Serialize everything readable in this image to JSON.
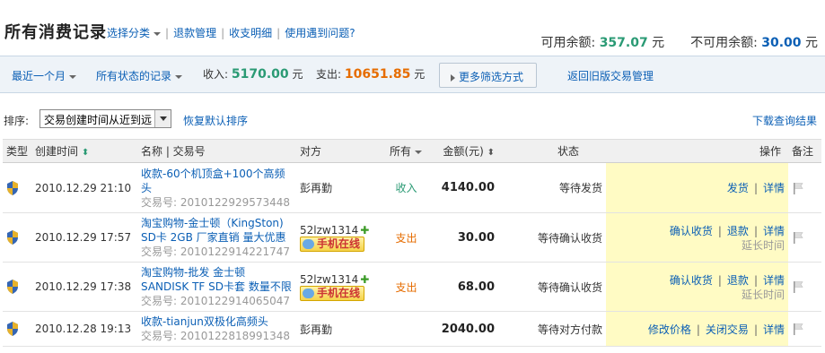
{
  "header": {
    "title": "所有消费记录",
    "links": [
      "选择分类",
      "退款管理",
      "收支明细",
      "使用遇到问题?"
    ],
    "available_label": "可用余额:",
    "available_value": "357.07",
    "unavailable_label": "不可用余额:",
    "unavailable_value": "30.00",
    "currency": "元"
  },
  "filter": {
    "period": "最近一个月",
    "status": "所有状态的记录",
    "income_label": "收入:",
    "income_value": "5170.00",
    "expense_label": "支出:",
    "expense_value": "10651.85",
    "currency": "元",
    "more_button": "更多筛选方式",
    "old_link": "返回旧版交易管理"
  },
  "sort": {
    "label": "排序:",
    "selected": "交易创建时间从近到远",
    "reset": "恢复默认排序",
    "download": "下载查询结果"
  },
  "table": {
    "headers": {
      "type": "类型",
      "created": "创建时间",
      "name": "名称 | 交易号",
      "party": "对方",
      "direction": "所有",
      "amount": "金额(元)",
      "status": "状态",
      "ops": "操作",
      "note": "备注"
    },
    "tid_label": "交易号:",
    "delay_label": "延长时间",
    "online_label": "手机在线",
    "rows": [
      {
        "time": "2010.12.29 21:10",
        "name1": "收款-60个机顶盒+100个高频",
        "name2": "头",
        "tid": "2010122929573448",
        "party": "彭再勤",
        "direction": "收入",
        "amount": "4140.00",
        "status": "等待发货",
        "op1": "发货",
        "op2": "详情"
      },
      {
        "time": "2010.12.29 17:57",
        "name1": "淘宝购物-金士顿（KingSton)",
        "name2": "SD卡 2GB 厂家直销 量大优惠",
        "tid": "2010122914221747",
        "party": "52lzw1314",
        "direction": "支出",
        "amount": "30.00",
        "status": "等待确认收货",
        "op1": "确认收货",
        "op2": "退款",
        "op3": "详情"
      },
      {
        "time": "2010.12.29 17:38",
        "name1": "淘宝购物-批发 金士顿",
        "name2": "SANDISK TF SD卡套 数量不限",
        "tid": "2010122914065047",
        "party": "52lzw1314",
        "direction": "支出",
        "amount": "68.00",
        "status": "等待确认收货",
        "op1": "确认收货",
        "op2": "退款",
        "op3": "详情"
      },
      {
        "time": "2010.12.28 19:13",
        "name1": "收款-tianjun双极化高频头",
        "tid": "2010122818991348",
        "party": "彭再勤",
        "direction": "",
        "amount": "2040.00",
        "status": "等待对方付款",
        "op1": "修改价格",
        "op2": "关闭交易",
        "op3": "详情"
      }
    ]
  }
}
